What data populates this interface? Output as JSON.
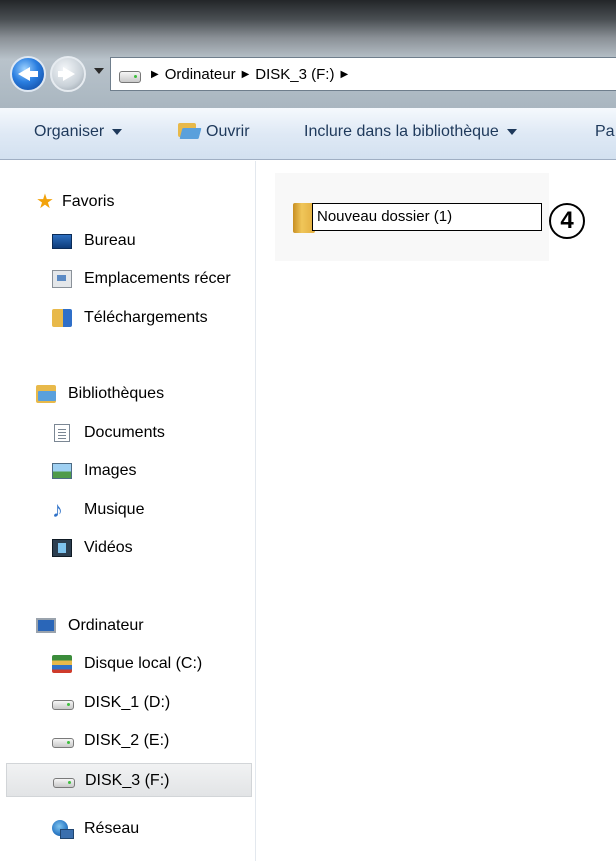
{
  "address": {
    "segments": [
      "Ordinateur",
      "DISK_3 (F:)"
    ]
  },
  "toolbar": {
    "organize": "Organiser",
    "open": "Ouvrir",
    "include_library": "Inclure dans la bibliothèque",
    "share_partial": "Pa"
  },
  "nav": {
    "favorites": {
      "label": "Favoris",
      "items": [
        "Bureau",
        "Emplacements récer",
        "Téléchargements"
      ]
    },
    "libraries": {
      "label": "Bibliothèques",
      "items": [
        "Documents",
        "Images",
        "Musique",
        "Vidéos"
      ]
    },
    "computer": {
      "label": "Ordinateur",
      "items": [
        "Disque local (C:)",
        "DISK_1 (D:)",
        "DISK_2 (E:)",
        "DISK_3 (F:)"
      ],
      "selected": "DISK_3 (F:)"
    },
    "network": {
      "label": "Réseau"
    }
  },
  "content": {
    "rename_value": "Nouveau dossier (1)",
    "step_badge": "4"
  },
  "icons": {
    "back": "back-arrow-icon",
    "forward": "forward-arrow-icon",
    "favorites": "star-icon",
    "desktop": "desktop-icon",
    "recent": "recent-places-icon",
    "downloads": "downloads-folder-icon",
    "libraries": "libraries-icon",
    "documents": "documents-icon",
    "images": "images-icon",
    "music": "music-note-icon",
    "videos": "videos-icon",
    "computer": "computer-icon",
    "local_disk": "local-disk-icon",
    "drive": "drive-icon",
    "network": "network-icon",
    "folder": "folder-icon"
  },
  "colors": {
    "command_bar_text": "#1e395b",
    "selection_bg": "#e2e4e6",
    "folder": "#e8b94a"
  }
}
